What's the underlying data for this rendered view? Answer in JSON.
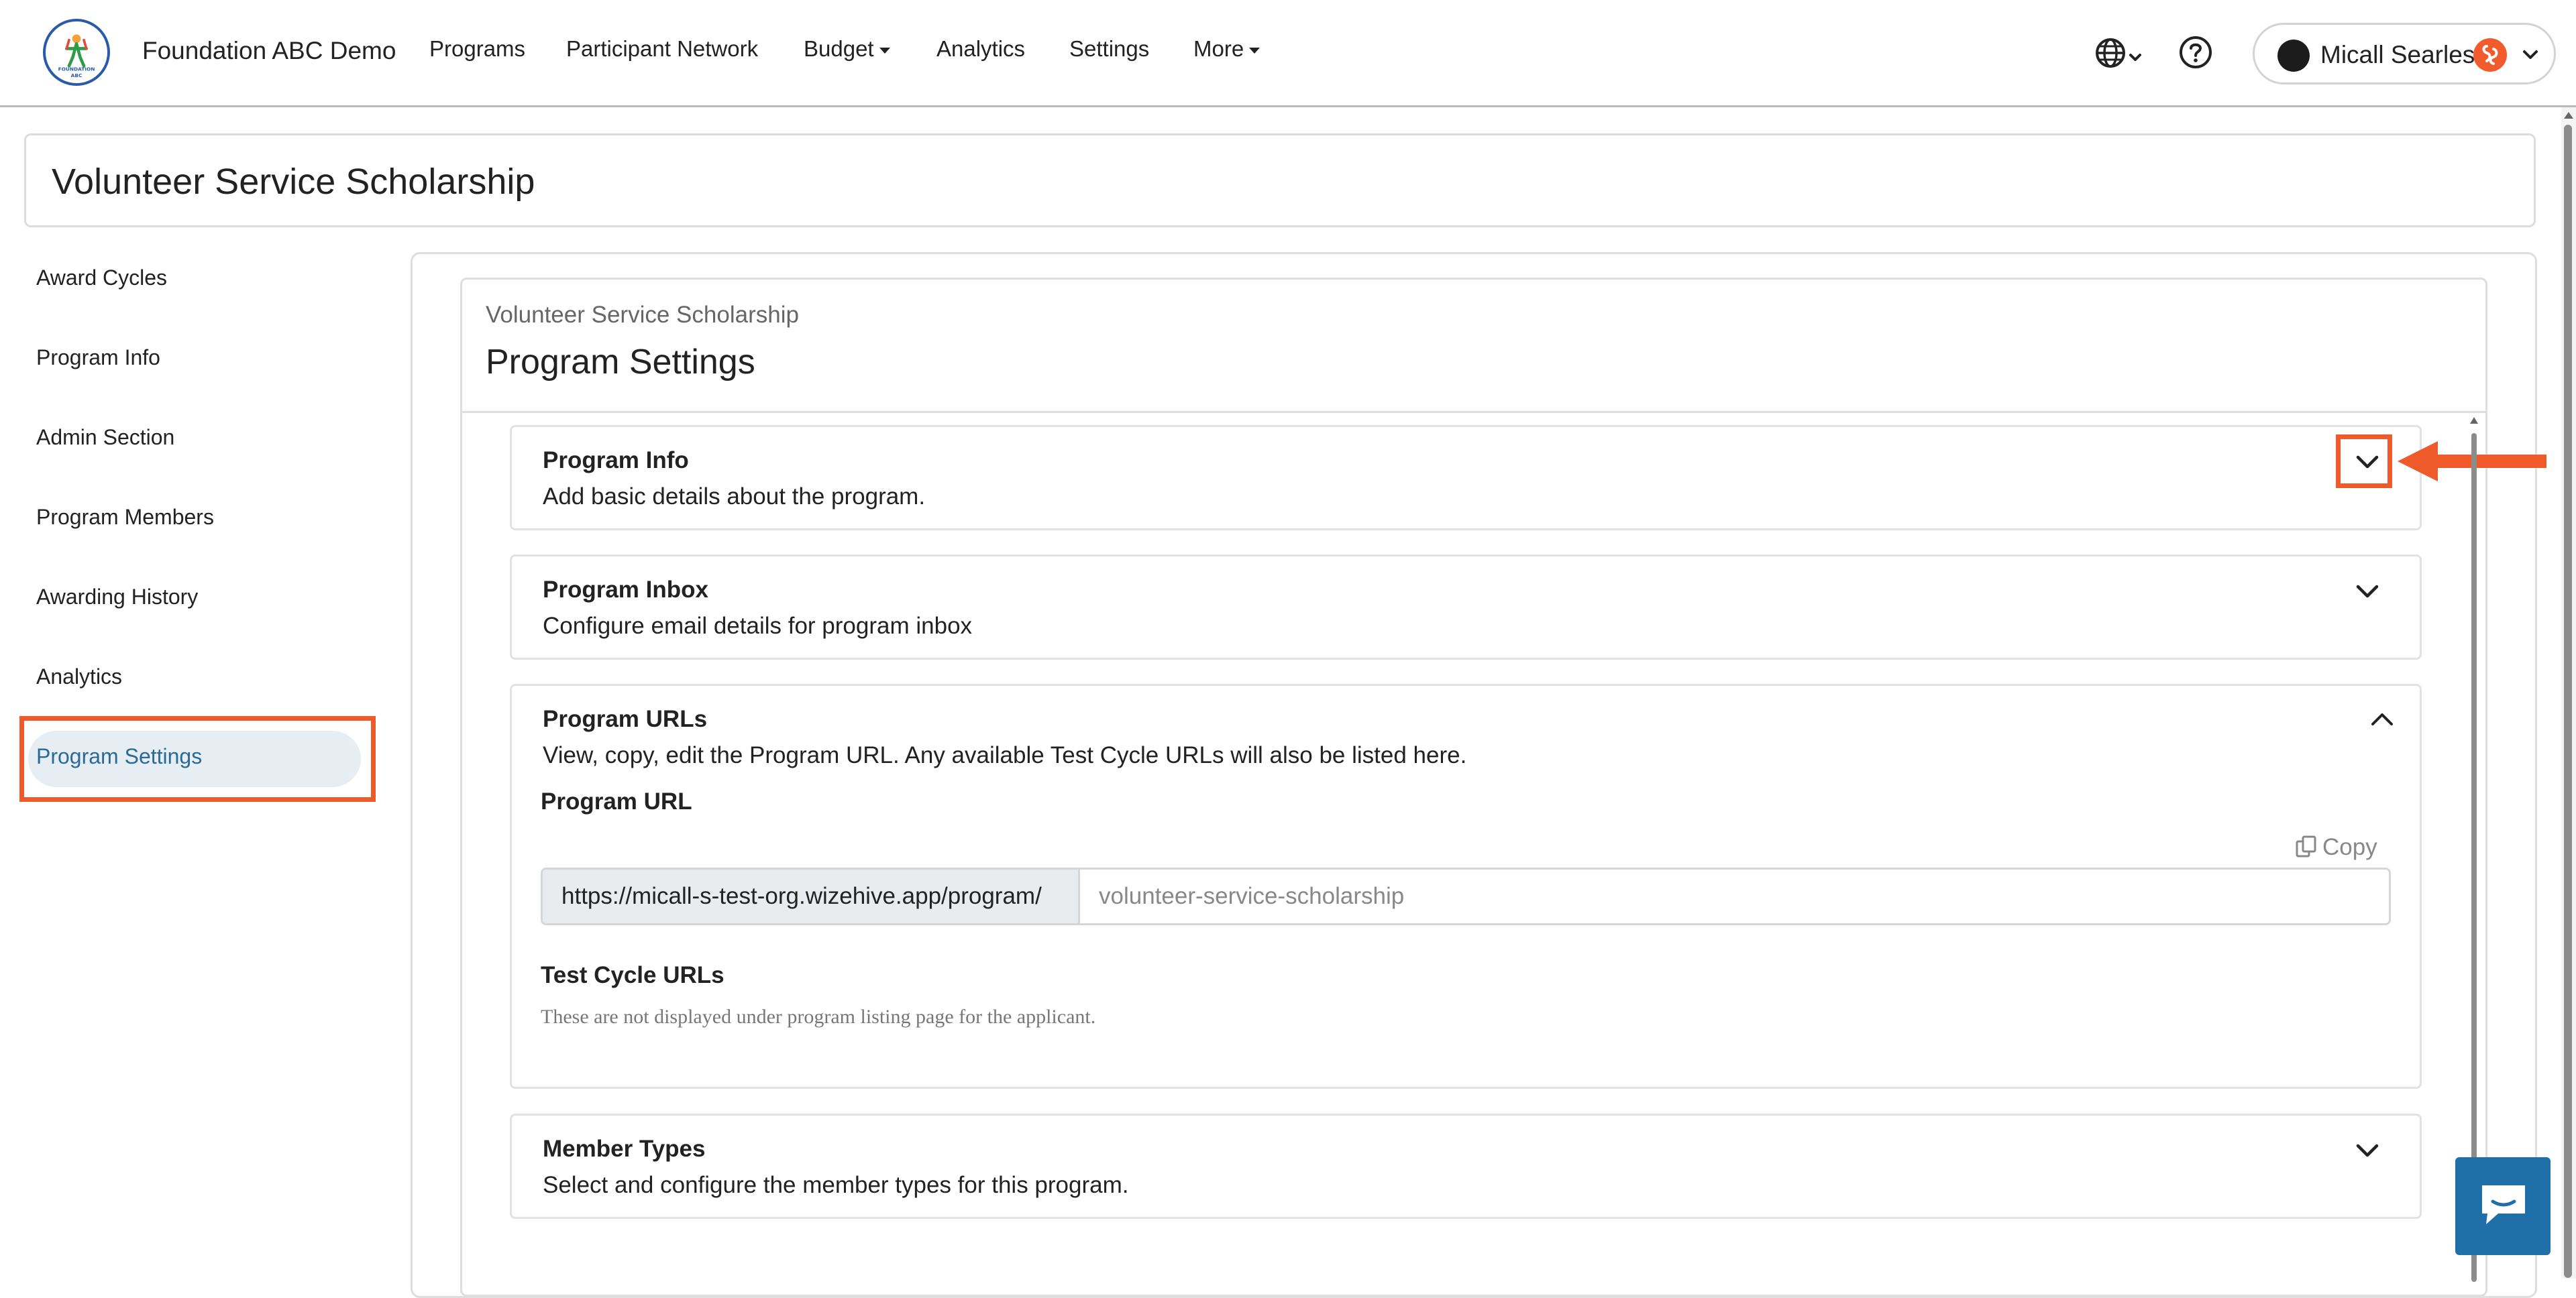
{
  "topbar": {
    "org_name": "Foundation ABC Demo",
    "logo_text": "FOUNDATION ABC",
    "nav": {
      "programs": "Programs",
      "participant_network": "Participant Network",
      "budget": "Budget",
      "analytics": "Analytics",
      "settings": "Settings",
      "more": "More"
    },
    "user_name": "Micall Searles"
  },
  "page": {
    "title": "Volunteer Service Scholarship"
  },
  "sidebar": {
    "items": [
      {
        "label": "Award Cycles"
      },
      {
        "label": "Program Info"
      },
      {
        "label": "Admin Section"
      },
      {
        "label": "Program Members"
      },
      {
        "label": "Awarding History"
      },
      {
        "label": "Analytics"
      },
      {
        "label": "Program Settings",
        "active": true
      }
    ]
  },
  "main": {
    "breadcrumb": "Volunteer Service Scholarship",
    "heading": "Program Settings",
    "cards": {
      "program_info": {
        "title": "Program Info",
        "description": "Add basic details about the program.",
        "expanded": false
      },
      "program_inbox": {
        "title": "Program Inbox",
        "description": "Configure email details for program inbox",
        "expanded": false
      },
      "program_urls": {
        "title": "Program URLs",
        "description": "View, copy, edit the Program URL. Any available Test Cycle URLs will also be listed here.",
        "expanded": true,
        "program_url_label": "Program URL",
        "copy_label": "Copy",
        "url_prefix": "https://micall-s-test-org.wizehive.app/program/",
        "url_slug": "volunteer-service-scholarship",
        "test_cycle_label": "Test Cycle URLs",
        "test_cycle_note": "These are not displayed under program listing page for the applicant."
      },
      "member_types": {
        "title": "Member Types",
        "description": "Select and configure the member types for this program.",
        "expanded": false
      }
    }
  },
  "colors": {
    "accent_highlight": "#ef5a2b",
    "active_item_text": "#2b6a94",
    "active_item_bg": "#e6eef3",
    "chat_button": "#1f6fa8"
  },
  "icons": [
    "globe-icon",
    "chevron-down-icon",
    "help-icon",
    "chevron-up-icon",
    "copy-icon",
    "chat-icon",
    "arrow-left-icon"
  ]
}
